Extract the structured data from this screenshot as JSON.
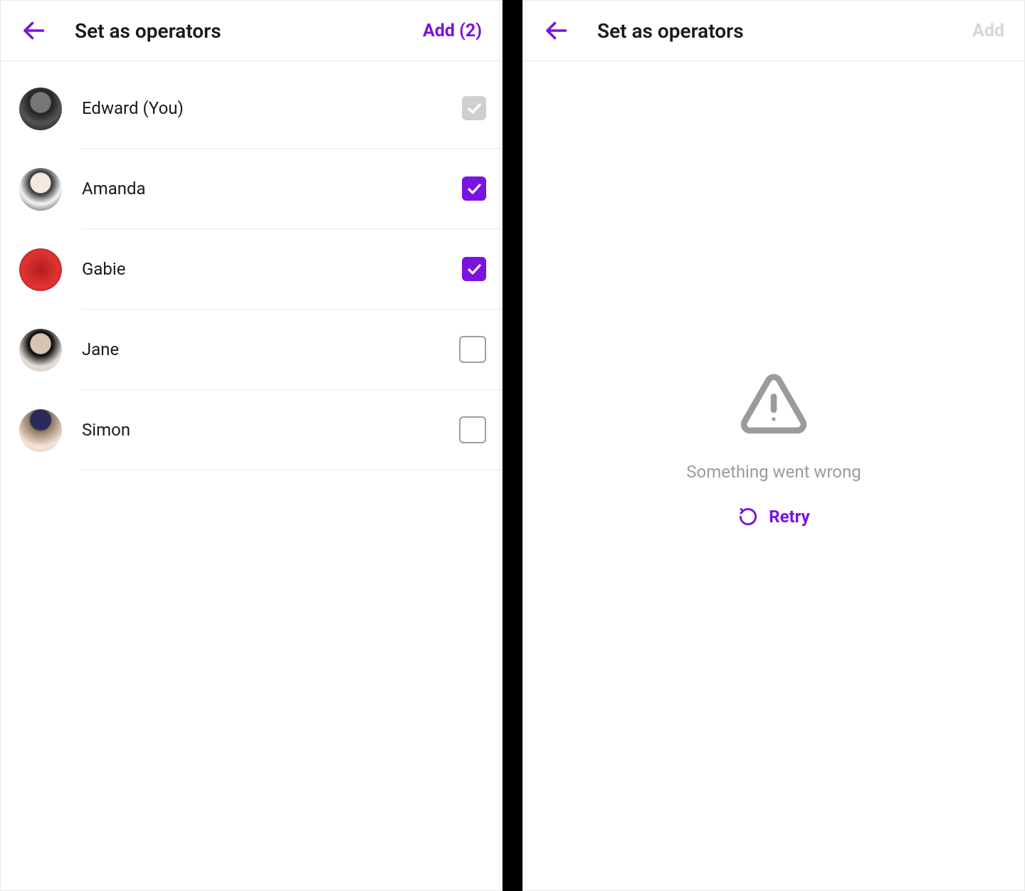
{
  "colors": {
    "accent": "#7a12e0"
  },
  "left": {
    "header": {
      "back_icon": "arrow-left",
      "title": "Set as operators",
      "action_label": "Add (2)",
      "action_enabled": true,
      "selected_count": 2
    },
    "members": [
      {
        "name": "Edward (You)",
        "checked": true,
        "disabled": true,
        "avatar": "av-bw"
      },
      {
        "name": "Amanda",
        "checked": true,
        "disabled": false,
        "avatar": "av-light"
      },
      {
        "name": "Gabie",
        "checked": true,
        "disabled": false,
        "avatar": "av-red"
      },
      {
        "name": "Jane",
        "checked": false,
        "disabled": false,
        "avatar": "av-jane"
      },
      {
        "name": "Simon",
        "checked": false,
        "disabled": false,
        "avatar": "av-cap"
      }
    ]
  },
  "right": {
    "header": {
      "back_icon": "arrow-left",
      "title": "Set as operators",
      "action_label": "Add",
      "action_enabled": false
    },
    "error": {
      "icon": "alert-triangle",
      "message": "Something went wrong",
      "retry_label": "Retry",
      "retry_icon": "refresh"
    }
  }
}
